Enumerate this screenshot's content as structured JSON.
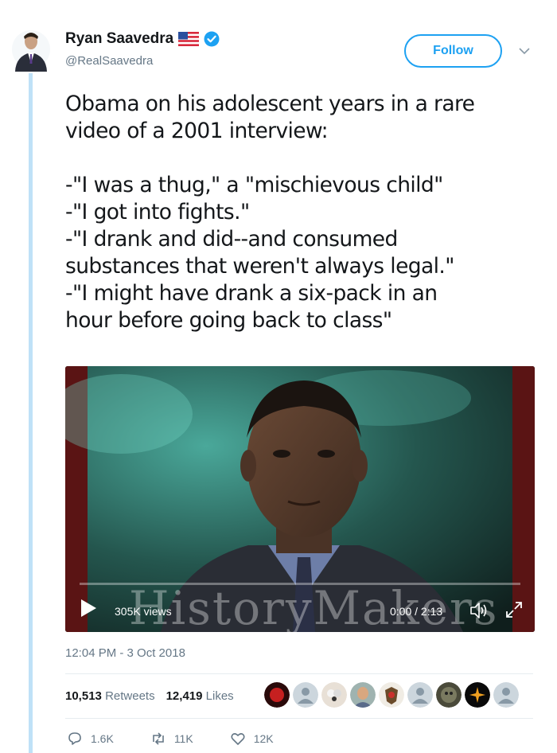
{
  "author": {
    "name": "Ryan Saavedra",
    "handle": "@RealSaavedra",
    "flag_icon": "us-flag-icon",
    "verified_icon": "verified-badge-icon"
  },
  "follow_label": "Follow",
  "tweet": {
    "lines": [
      "Obama on his adolescent years in a rare",
      "video of a 2001 interview:",
      "",
      "-\"I was a thug,\" a \"mischievous child\"",
      "-\"I got into fights.\"",
      "-\"I drank and did--and consumed",
      "substances that weren't always legal.\"",
      "-\"I might have drank a six-pack in an",
      "hour before going back to class\""
    ]
  },
  "video": {
    "views": "305K views",
    "time": "0:00 / 2:13",
    "watermark": "HistoryMakers",
    "progress": 0.0
  },
  "timestamp": "12:04 PM - 3 Oct 2018",
  "stats": {
    "retweets_count": "10,513",
    "retweets_label": "Retweets",
    "likes_count": "12,419",
    "likes_label": "Likes"
  },
  "actions": {
    "replies": "1.6K",
    "retweets": "11K",
    "likes": "12K"
  },
  "colors": {
    "accent": "#1da1f2",
    "muted": "#657786",
    "thread_line": "#bfe1f7"
  }
}
